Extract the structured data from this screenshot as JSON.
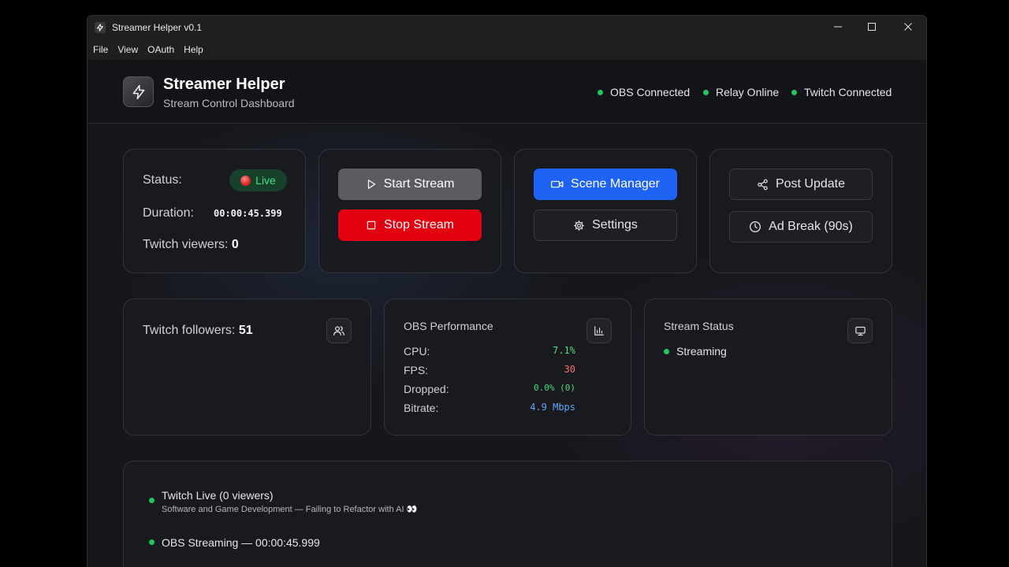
{
  "window": {
    "title": "Streamer Helper v0.1",
    "menu": [
      "File",
      "View",
      "OAuth",
      "Help"
    ]
  },
  "header": {
    "title": "Streamer Helper",
    "subtitle": "Stream Control Dashboard",
    "connections": [
      "OBS Connected",
      "Relay Online",
      "Twitch Connected"
    ]
  },
  "status_card": {
    "status_label": "Status:",
    "status_value": "Live",
    "duration_label": "Duration:",
    "duration_value": "00:00:45.399",
    "viewers_label": "Twitch viewers:",
    "viewers_value": "0"
  },
  "stream_controls": {
    "start_label": "Start Stream",
    "stop_label": "Stop Stream"
  },
  "scene_controls": {
    "scene_label": "Scene Manager",
    "settings_label": "Settings"
  },
  "post_controls": {
    "post_label": "Post Update",
    "ad_label": "Ad Break (90s)"
  },
  "followers_card": {
    "label": "Twitch followers:",
    "value": "51"
  },
  "obs_performance": {
    "title": "OBS Performance",
    "rows": [
      {
        "label": "CPU:",
        "value": "7.1%"
      },
      {
        "label": "FPS:",
        "value": "30"
      },
      {
        "label": "Dropped:",
        "value": "0.0% (0)"
      },
      {
        "label": "Bitrate:",
        "value": "4.9 Mbps"
      }
    ]
  },
  "stream_status": {
    "title": "Stream Status",
    "value": "Streaming"
  },
  "activity": [
    {
      "title": "Twitch Live (0 viewers)",
      "subtitle": "Software and Game Development — Failing to Refactor with AI 👀"
    },
    {
      "title": "OBS Streaming — 00:00:45.999",
      "subtitle": ""
    }
  ],
  "colors": {
    "accent_blue": "#1f63f5",
    "stop_red": "#e3000f",
    "status_green": "#22c55e",
    "cpu_green": "#4ade80",
    "fps_red": "#f87171",
    "bitrate_blue": "#60a5fa"
  },
  "icons": {
    "brand": "lightning-icon",
    "start": "play-icon",
    "stop": "stop-square-icon",
    "scene": "video-camera-icon",
    "settings": "gear-icon",
    "post": "share-icon",
    "ad": "clock-icon",
    "followers": "users-icon",
    "performance": "bar-chart-icon",
    "stream_status": "monitor-icon"
  }
}
